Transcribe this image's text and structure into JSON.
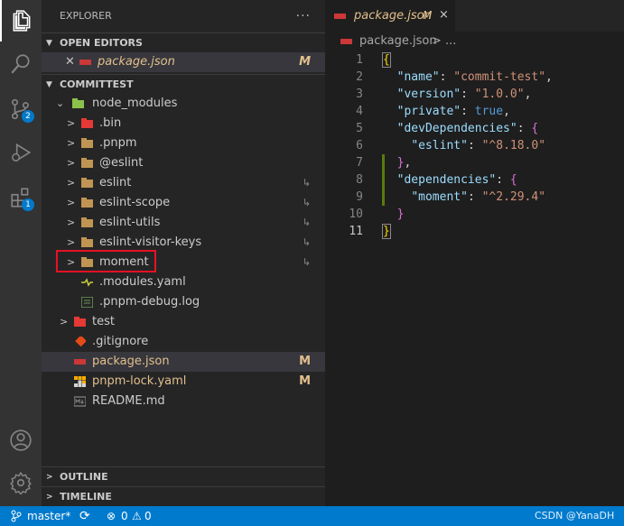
{
  "explorer": {
    "title": "EXPLORER",
    "more": "···",
    "open_editors": "OPEN EDITORS",
    "open_file": "package.json",
    "open_file_badge": "M",
    "project": "COMMITTEST",
    "outline": "OUTLINE",
    "timeline": "TIMELINE"
  },
  "tree": [
    {
      "label": "node_modules"
    },
    {
      "label": ".bin"
    },
    {
      "label": ".pnpm"
    },
    {
      "label": "@eslint"
    },
    {
      "label": "eslint"
    },
    {
      "label": "eslint-scope"
    },
    {
      "label": "eslint-utils"
    },
    {
      "label": "eslint-visitor-keys"
    },
    {
      "label": "moment"
    },
    {
      "label": ".modules.yaml"
    },
    {
      "label": ".pnpm-debug.log"
    },
    {
      "label": "test"
    },
    {
      "label": ".gitignore"
    },
    {
      "label": "package.json",
      "badge": "M"
    },
    {
      "label": "pnpm-lock.yaml",
      "badge": "M"
    },
    {
      "label": "README.md"
    }
  ],
  "badges": {
    "scm": "2",
    "extensions": "1"
  },
  "editor": {
    "tab_label": "package.json",
    "tab_badge": "M",
    "close": "×",
    "crumb_file": "package.json",
    "crumb_rest": "> ..."
  },
  "code_lines": [
    "1",
    "2",
    "3",
    "4",
    "5",
    "6",
    "7",
    "8",
    "9",
    "10",
    "11"
  ],
  "code": {
    "l2k": "\"name\"",
    "l2v": "\"commit-test\"",
    "l3k": "\"version\"",
    "l3v": "\"1.0.0\"",
    "l4k": "\"private\"",
    "l4v": "true",
    "l5k": "\"devDependencies\"",
    "l6k": "\"eslint\"",
    "l6v": "\"^8.18.0\"",
    "l8k": "\"dependencies\"",
    "l9k": "\"moment\"",
    "l9v": "\"^2.29.4\""
  },
  "status": {
    "branch": "master*",
    "errors": "0",
    "warnings": "0",
    "watermark": "CSDN @YanaDH"
  },
  "colors": {
    "accent": "#007acc",
    "modified": "#e2c08d",
    "highlight_box": "#e81123"
  }
}
